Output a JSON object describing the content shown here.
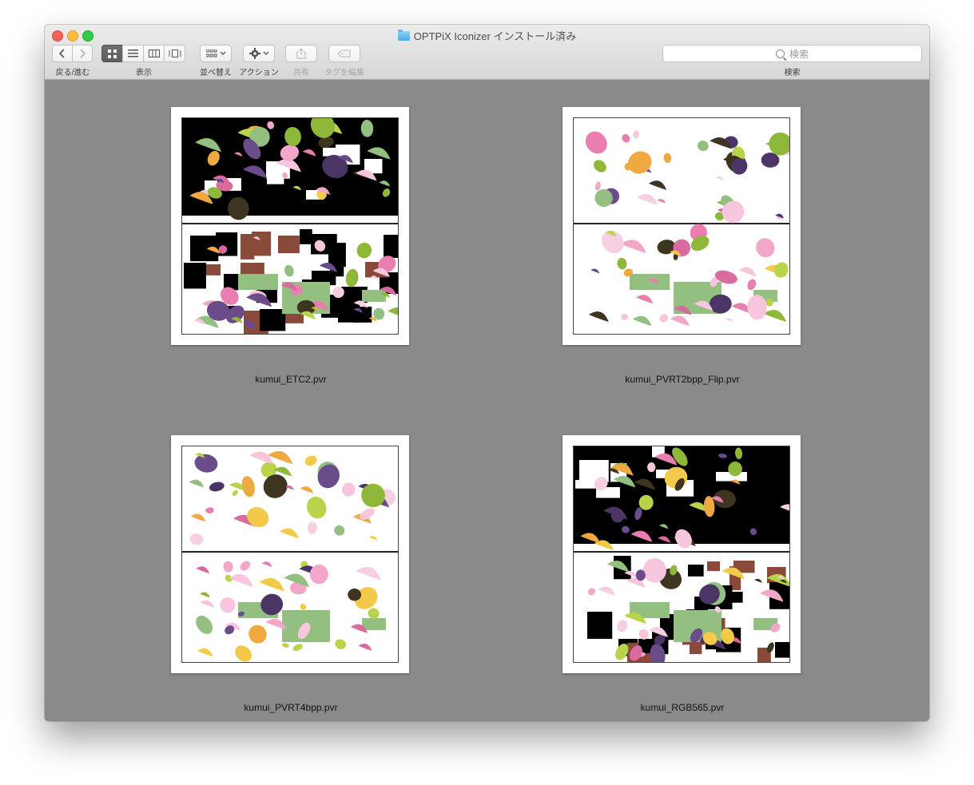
{
  "window": {
    "title": "OPTPiX Iconizer インストール済み",
    "folder_icon": "folder-icon"
  },
  "toolbar": {
    "back_forward_label": "戻る/進む",
    "view_label": "表示",
    "sort_label": "並べ替え",
    "action_label": "アクション",
    "share_label": "共有",
    "tags_label": "タグを編集",
    "search_label": "検索",
    "search_placeholder": "検索",
    "view_modes": [
      "icon-view",
      "list-view",
      "column-view",
      "coverflow-view"
    ],
    "active_view": "icon-view"
  },
  "files": [
    {
      "name": "kumui_ETC2.pvr",
      "background": "black"
    },
    {
      "name": "kumui_PVRT2bpp_Flip.pvr",
      "background": "white"
    },
    {
      "name": "kumui_PVRT4bpp.pvr",
      "background": "white"
    },
    {
      "name": "kumui_RGB565.pvr",
      "background": "black"
    }
  ],
  "colors": {
    "finder_background": "#8a8a8a",
    "toolbar_top": "#ececec",
    "toolbar_bottom": "#d6d6d6",
    "close": "#fc605c",
    "minimize": "#fdbc40",
    "maximize": "#34c84a"
  }
}
